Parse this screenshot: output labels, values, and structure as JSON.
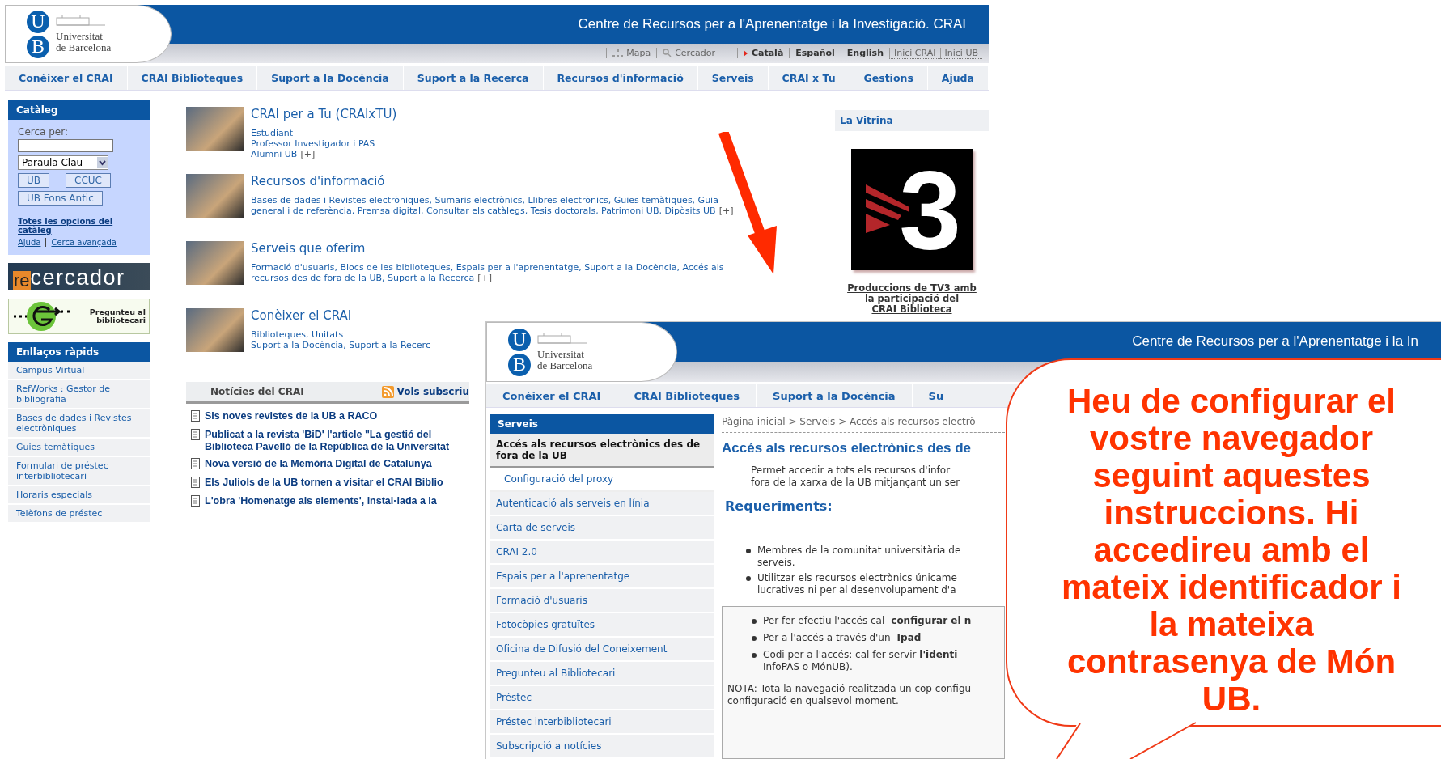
{
  "main_page": {
    "logo": {
      "letters": [
        "U",
        "B"
      ],
      "name": "Universitat\nde Barcelona"
    },
    "header_title": "Centre de Recursos per a l'Aprenentatge i la Investigació. CRAI",
    "utility_links": [
      {
        "label": "Mapa",
        "kind": "map"
      },
      {
        "label": "Cercador",
        "kind": "search"
      }
    ],
    "languages": [
      {
        "label": "Català",
        "selected": true
      },
      {
        "label": "Español",
        "selected": false
      },
      {
        "label": "English",
        "selected": false
      }
    ],
    "home_links": [
      "Inici CRAI",
      "Inici UB"
    ],
    "nav": [
      "Conèixer el CRAI",
      "CRAI Biblioteques",
      "Suport a la Docència",
      "Suport a la Recerca",
      "Recursos d'informació",
      "Serveis",
      "CRAI x Tu",
      "Gestions",
      "Ajuda"
    ],
    "catalog": {
      "title": "Catàleg",
      "search_label": "Cerca per:",
      "select_value": "Paraula Clau",
      "buttons": [
        "UB",
        "CCUC",
        "UB Fons Antic"
      ],
      "all_options": "Totes les opcions del catàleg",
      "links": [
        "Ajuda",
        "Cerca avançada"
      ]
    },
    "recercador": {
      "prefix": "re",
      "rest": "cercador"
    },
    "ask_banner": "Pregunteu al\nbibliotecari",
    "quick_links": {
      "title": "Enllaços ràpids",
      "items": [
        "Campus Virtual",
        "RefWorks : Gestor de bibliografia",
        "Bases de dades i Revistes electròniques",
        "Guies temàtiques",
        "Formulari de préstec interbibliotecari",
        "Horaris especials",
        "Telèfons de préstec"
      ]
    },
    "sections": [
      {
        "title": "CRAI per a Tu (CRAIxTU)",
        "lines": [
          "Estudiant",
          "Professor Investigador i PAS",
          "Alumni UB"
        ],
        "more": "[+]"
      },
      {
        "title": "Recursos d'informació",
        "lines": [
          "Bases de dades i Revistes electròniques, Sumaris electrònics, Llibres electrònics, Guies temàtiques, Guia",
          "general i de referència, Premsa digital, Consultar els catàlegs, Tesis doctorals, Patrimoni UB, Dipòsits UB"
        ],
        "more": "[+]"
      },
      {
        "title": "Serveis que oferim",
        "lines": [
          "Formació d'usuaris, Blocs de les biblioteques, Espais per a l'aprenentatge, Suport a la Docència, Accés als",
          "recursos des de fora de la UB, Suport a la Recerca"
        ],
        "more": "[+]"
      },
      {
        "title": "Conèixer el CRAI",
        "lines": [
          "Biblioteques, Unitats",
          "Suport a la Docència, Suport a la Recerc"
        ]
      }
    ],
    "news": {
      "title": "Notícies del CRAI",
      "subscribe": "Vols subscriu",
      "items": [
        "Sis noves revistes de la UB a RACO",
        "Publicat a la revista 'BiD' l'article \"La gestió del\nBiblioteca Pavelló de la República de la Universitat",
        "Nova versió de la Memòria Digital de Catalunya",
        "Els Juliols de la UB tornen a visitar el CRAI Biblio",
        "L'obra 'Homenatge als elements', instal·lada a la"
      ]
    },
    "showcase": {
      "title": "La Vitrina",
      "logo_text": "3",
      "caption": "Produccions de TV3 amb\nla participació del\nCRAI Biblioteca"
    }
  },
  "detail_page": {
    "logo": {
      "letters": [
        "U",
        "B"
      ],
      "name": "Universitat\nde Barcelona"
    },
    "header_title": "Centre de Recursos per a l'Aprenentatge i la In",
    "nav": [
      "Conèixer el CRAI",
      "CRAI Biblioteques",
      "Suport a la Docència",
      "Su"
    ],
    "sidebar": {
      "title": "Serveis",
      "items": [
        {
          "label": "Accés als recursos electrònics des de fora de la UB",
          "kind": "current"
        },
        {
          "label": "Configuració del proxy",
          "kind": "sub"
        },
        {
          "label": "Autenticació als serveis en línia",
          "kind": "item"
        },
        {
          "label": "Carta de serveis",
          "kind": "item"
        },
        {
          "label": "CRAI 2.0",
          "kind": "item"
        },
        {
          "label": "Espais per a l'aprenentatge",
          "kind": "item"
        },
        {
          "label": "Formació d'usuaris",
          "kind": "item"
        },
        {
          "label": "Fotocòpies gratuïtes",
          "kind": "item"
        },
        {
          "label": "Oficina de Difusió del Coneixement",
          "kind": "item"
        },
        {
          "label": "Pregunteu al Bibliotecari",
          "kind": "item"
        },
        {
          "label": "Préstec",
          "kind": "item"
        },
        {
          "label": "Préstec interbibliotecari",
          "kind": "item"
        },
        {
          "label": "Subscripció a notícies",
          "kind": "item"
        }
      ]
    },
    "breadcrumb": "Pàgina inicial > Serveis  > Accés als recursos electrò",
    "title": "Accés als recursos electrònics des de",
    "intro": "Permet accedir a tots els recursos d'infor\nfora de la xarxa de la UB mitjançant un ser",
    "requirements_title": "Requeriments:",
    "requirements": [
      "Membres de la comunitat universitària de\nserveis.",
      "Utilitzar els recursos electrònics únicame\nlucratives ni per al desenvolupament d'a"
    ],
    "notes": [
      {
        "text": "Per fer efectiu l'accés cal",
        "link": "configurar el n"
      },
      {
        "text": "Per a l'accés a través d'un",
        "link": "Ipad"
      },
      {
        "text": "Codi per a l'accés: cal fer servir **l'identi**\nInfoPAS o MónUB)."
      }
    ],
    "note": "NOTA: Tota la navegació realitzada un cop configu\nconfiguració en qualsevol moment."
  },
  "callout": "Heu de configurar el vostre navegador seguint aquestes instruccions. Hi accedireu amb el mateix identificador i la mateixa contrasenya de Món UB."
}
